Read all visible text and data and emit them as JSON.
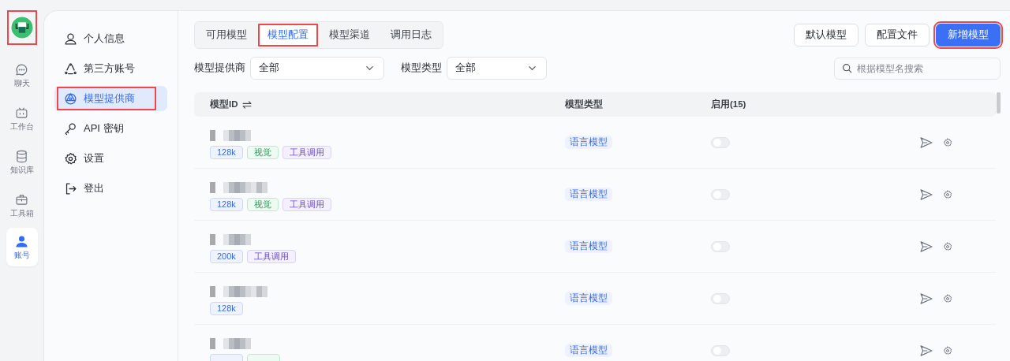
{
  "app_logo": {
    "highlighted": true
  },
  "rail": [
    {
      "label": "聊天",
      "selected": false
    },
    {
      "label": "工作台",
      "selected": false
    },
    {
      "label": "知识库",
      "selected": false
    },
    {
      "label": "工具箱",
      "selected": false
    },
    {
      "label": "账号",
      "selected": true
    }
  ],
  "settings_nav": [
    {
      "label": "个人信息",
      "selected": false,
      "highlighted": false
    },
    {
      "label": "第三方账号",
      "selected": false,
      "highlighted": false
    },
    {
      "label": "模型提供商",
      "selected": true,
      "highlighted": true
    },
    {
      "label": "API 密钥",
      "selected": false,
      "highlighted": false
    },
    {
      "label": "设置",
      "selected": false,
      "highlighted": false
    },
    {
      "label": "登出",
      "selected": false,
      "highlighted": false
    }
  ],
  "tabs": [
    {
      "label": "可用模型",
      "selected": false,
      "highlighted": false
    },
    {
      "label": "模型配置",
      "selected": true,
      "highlighted": true
    },
    {
      "label": "模型渠道",
      "selected": false,
      "highlighted": false
    },
    {
      "label": "调用日志",
      "selected": false,
      "highlighted": false
    }
  ],
  "buttons": [
    {
      "label": "默认模型",
      "kind": "secondary",
      "highlighted": false
    },
    {
      "label": "配置文件",
      "kind": "secondary",
      "highlighted": false
    },
    {
      "label": "新增模型",
      "kind": "primary",
      "highlighted": true
    }
  ],
  "filters": [
    {
      "label": "模型提供商",
      "value": "全部"
    },
    {
      "label": "模型类型",
      "value": "全部"
    }
  ],
  "search": {
    "placeholder": "根据模型名搜索"
  },
  "table": {
    "columns": [
      "模型ID",
      "模型类型",
      "启用(15)"
    ],
    "rows": [
      {
        "id": {
          "kind": "redacted"
        },
        "tags": [
          {
            "kind": "context",
            "label": "128k"
          },
          {
            "kind": "vision",
            "label": "视觉"
          },
          {
            "kind": "tools",
            "label": "工具调用"
          }
        ],
        "type": "语言模型",
        "on": false
      },
      {
        "id": {
          "kind": "redacted"
        },
        "tags": [
          {
            "kind": "context",
            "label": "128k"
          },
          {
            "kind": "vision",
            "label": "视觉"
          },
          {
            "kind": "tools",
            "label": "工具调用"
          }
        ],
        "type": "语言模型",
        "on": false
      },
      {
        "id": {
          "kind": "redacted"
        },
        "tags": [
          {
            "kind": "context",
            "label": "200k"
          },
          {
            "kind": "tools",
            "label": "工具调用"
          }
        ],
        "type": "语言模型",
        "on": false
      },
      {
        "id": {
          "kind": "redacted"
        },
        "tags": [
          {
            "kind": "context",
            "label": "128k"
          }
        ],
        "type": "语言模型",
        "on": false
      },
      {
        "id": {
          "kind": "redacted"
        },
        "tags": [
          {
            "kind": "context"
          },
          {
            "kind": "vision"
          }
        ],
        "type": "语言模型",
        "on": false
      }
    ]
  }
}
